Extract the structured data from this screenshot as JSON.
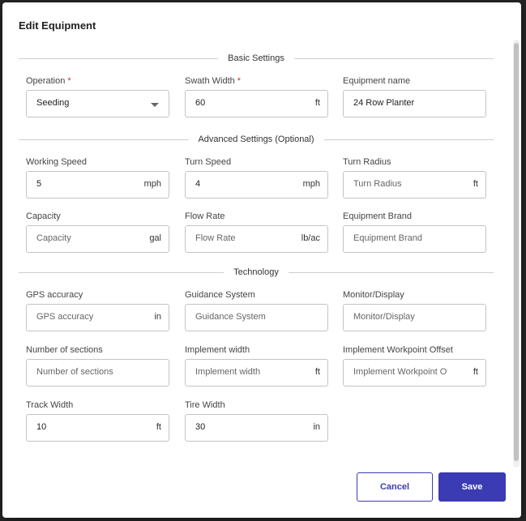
{
  "dialog": {
    "title": "Edit Equipment"
  },
  "sections": {
    "basic": "Basic Settings",
    "advanced": "Advanced Settings (Optional)",
    "technology": "Technology"
  },
  "fields": {
    "operation": {
      "label": "Operation",
      "required": "*",
      "value": "Seeding",
      "options_visible": [
        "Seeding"
      ]
    },
    "swath_width": {
      "label": "Swath Width",
      "required": "*",
      "value": "60",
      "unit": "ft"
    },
    "equipment_name": {
      "label": "Equipment name",
      "value": "24 Row Planter"
    },
    "working_speed": {
      "label": "Working Speed",
      "value": "5",
      "unit": "mph"
    },
    "turn_speed": {
      "label": "Turn Speed",
      "value": "4",
      "unit": "mph"
    },
    "turn_radius": {
      "label": "Turn Radius",
      "placeholder": "Turn Radius",
      "unit": "ft"
    },
    "capacity": {
      "label": "Capacity",
      "placeholder": "Capacity",
      "unit": "gal"
    },
    "flow_rate": {
      "label": "Flow Rate",
      "placeholder": "Flow Rate",
      "unit": "lb/ac"
    },
    "equipment_brand": {
      "label": "Equipment Brand",
      "placeholder": "Equipment Brand"
    },
    "gps_accuracy": {
      "label": "GPS accuracy",
      "placeholder": "GPS accuracy",
      "unit": "in"
    },
    "guidance_system": {
      "label": "Guidance System",
      "placeholder": "Guidance System"
    },
    "monitor_display": {
      "label": "Monitor/Display",
      "placeholder": "Monitor/Display"
    },
    "number_of_sections": {
      "label": "Number of sections",
      "placeholder": "Number of sections"
    },
    "implement_width": {
      "label": "Implement width",
      "placeholder": "Implement width",
      "unit": "ft"
    },
    "implement_workpoint_offset": {
      "label": "Implement Workpoint Offset",
      "placeholder": "Implement Workpoint Offset",
      "unit": "ft"
    },
    "track_width": {
      "label": "Track Width",
      "value": "10",
      "unit": "ft"
    },
    "tire_width": {
      "label": "Tire Width",
      "value": "30",
      "unit": "in"
    }
  },
  "buttons": {
    "cancel": "Cancel",
    "save": "Save"
  },
  "colors": {
    "accent": "#3b3bb3",
    "required": "#d32f2f"
  }
}
